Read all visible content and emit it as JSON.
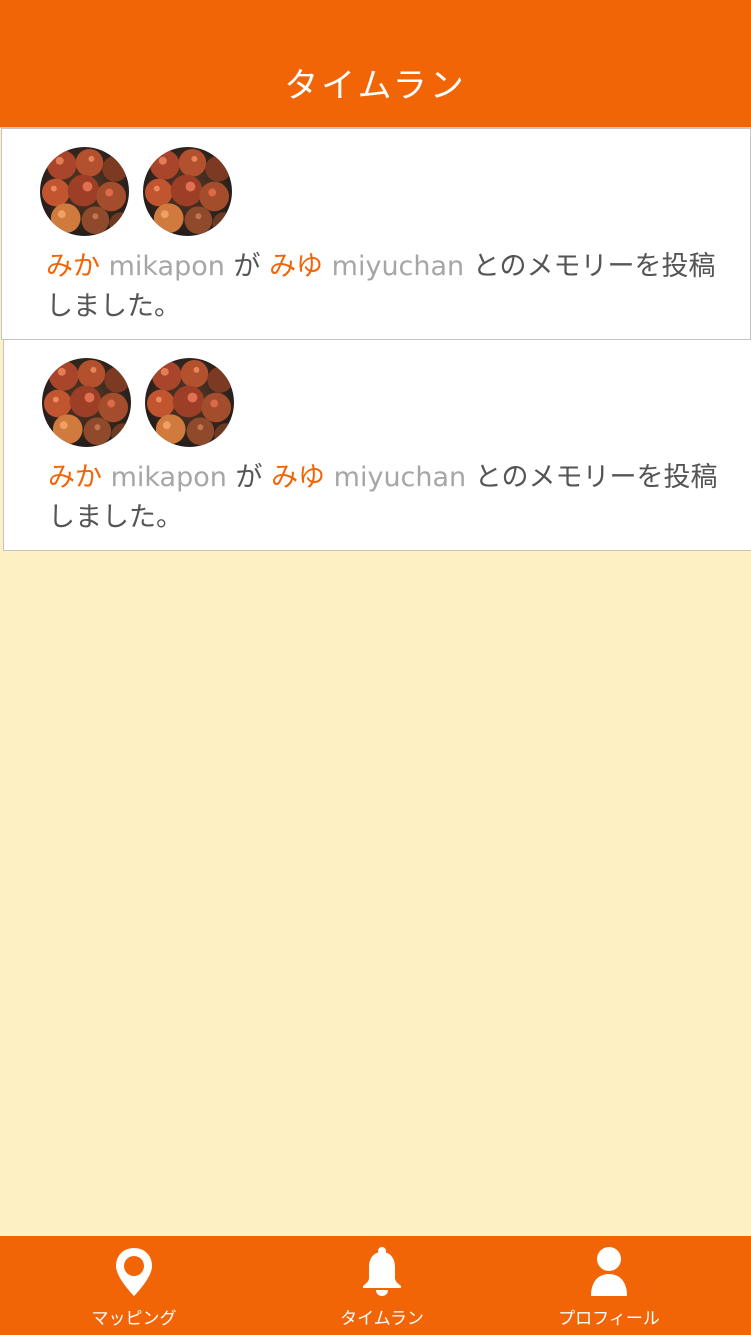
{
  "header": {
    "title": "タイムラン"
  },
  "posts": [
    {
      "author_name": "みか",
      "author_id": "mikapon",
      "particle": "が",
      "partner_name": "みゆ",
      "partner_id": "miyuchan",
      "message": "とのメモリーを投稿しました。"
    },
    {
      "author_name": "みか",
      "author_id": "mikapon",
      "particle": "が",
      "partner_name": "みゆ",
      "partner_id": "miyuchan",
      "message": "とのメモリーを投稿しました。"
    }
  ],
  "tabbar": {
    "items": [
      {
        "label": "マッピング",
        "icon": "map-pin-icon"
      },
      {
        "label": "タイムラン",
        "icon": "bell-icon"
      },
      {
        "label": "プロフィール",
        "icon": "person-icon"
      }
    ]
  },
  "colors": {
    "accent": "#f26507",
    "background": "#fdf1c4",
    "user_id": "#a6a6a6",
    "text": "#555555"
  }
}
